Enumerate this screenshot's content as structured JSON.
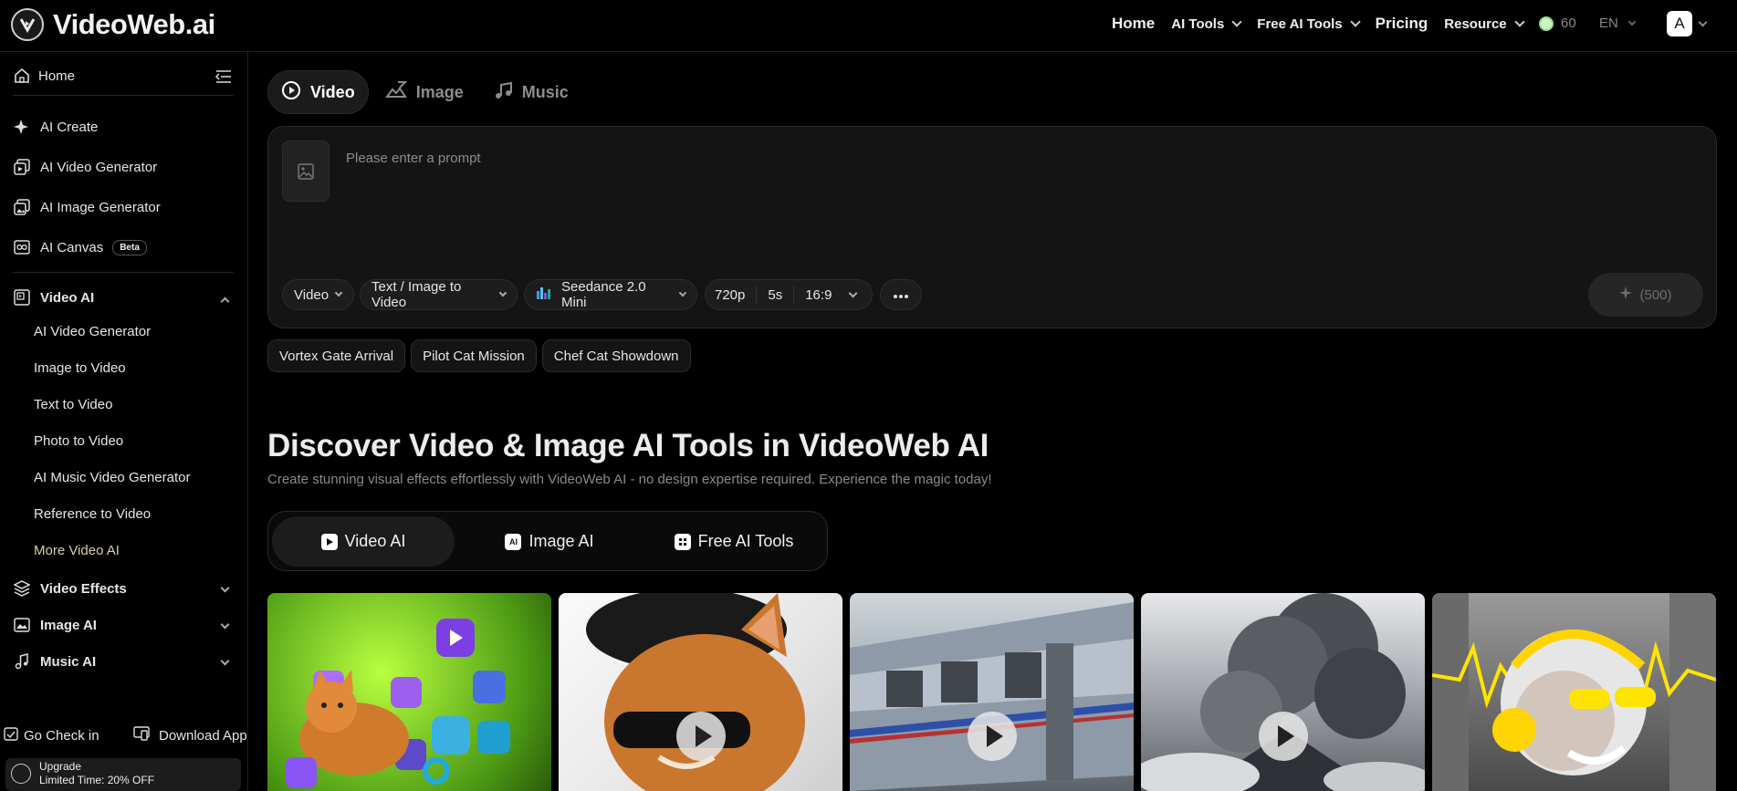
{
  "header": {
    "brand": "VideoWeb.ai",
    "nav": [
      {
        "label": "Home",
        "has_menu": false
      },
      {
        "label": "AI Tools",
        "has_menu": true
      },
      {
        "label": "Free AI Tools",
        "has_menu": true
      },
      {
        "label": "Pricing",
        "has_menu": false
      },
      {
        "label": "Resource",
        "has_menu": true
      }
    ],
    "credits": "60",
    "language": "EN",
    "avatar_letter": "A"
  },
  "sidebar": {
    "home": "Home",
    "top_items": [
      {
        "label": "AI Create",
        "icon": "sparkle-icon"
      },
      {
        "label": "AI Video Generator",
        "icon": "video-stack-icon"
      },
      {
        "label": "AI Image Generator",
        "icon": "image-stack-icon"
      },
      {
        "label": "AI Canvas",
        "icon": "infinity-icon",
        "badge": "Beta"
      }
    ],
    "video_ai": {
      "label": "Video AI",
      "expanded": true,
      "items": [
        "AI Video Generator",
        "Image to Video",
        "Text to Video",
        "Photo to Video",
        "AI Music Video Generator",
        "Reference to Video",
        "More Video AI"
      ]
    },
    "sections": [
      {
        "label": "Video Effects",
        "icon": "layers-icon"
      },
      {
        "label": "Image AI",
        "icon": "image-icon"
      },
      {
        "label": "Music AI",
        "icon": "music-icon"
      }
    ],
    "check_in": "Go Check in",
    "download": "Download App",
    "upgrade_title": "Upgrade",
    "upgrade_sub": "Limited Time: 20% OFF"
  },
  "creator": {
    "modes": [
      {
        "label": "Video",
        "active": true
      },
      {
        "label": "Image",
        "active": false
      },
      {
        "label": "Music",
        "active": false
      }
    ],
    "prompt_placeholder": "Please enter a prompt",
    "options": {
      "type": "Video",
      "mode": "Text / Image to Video",
      "model": "Seedance 2.0 Mini",
      "resolution": "720p",
      "duration": "5s",
      "ratio": "16:9"
    },
    "generate_cost": "(500)"
  },
  "suggestions": [
    "Vortex Gate Arrival",
    "Pilot Cat Mission",
    "Chef Cat Showdown"
  ],
  "discover": {
    "title": "Discover Video & Image AI Tools in VideoWeb AI",
    "subtitle": "Create stunning visual effects effortlessly with VideoWeb AI - no design expertise required. Experience the magic today!",
    "tabs": [
      {
        "label": "Video AI",
        "active": true
      },
      {
        "label": "Image AI",
        "active": false
      },
      {
        "label": "Free AI Tools",
        "active": false
      }
    ]
  },
  "colors": {
    "background": "#000000",
    "panel": "#141414",
    "accent_muted": "#d8d0a8"
  }
}
